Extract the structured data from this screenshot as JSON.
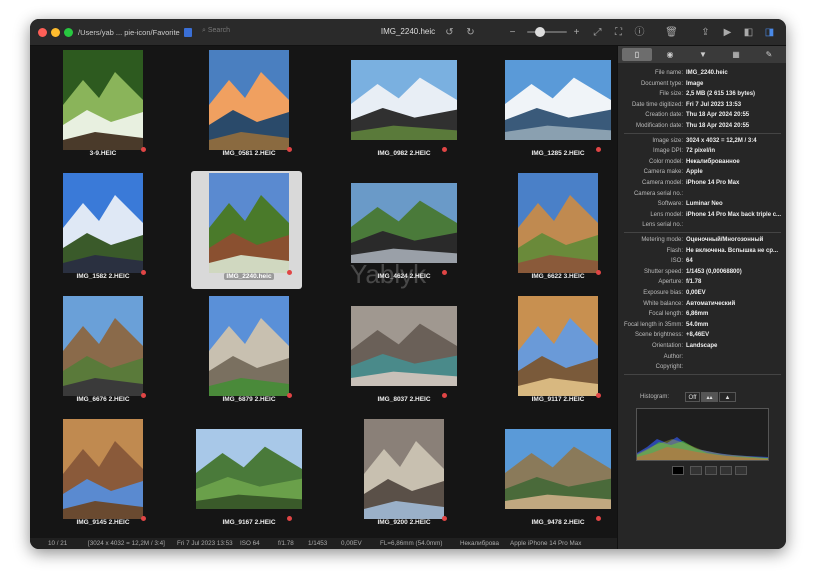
{
  "window": {
    "path": "/Users/yab ... pie-icon/Favorite",
    "search_placeholder": "Search",
    "title": "IMG_2240.heic",
    "watermark": "Yablyk"
  },
  "toolbar": {
    "icons": [
      "rotate-left-icon",
      "rotate-right-icon",
      "zoom-out-icon",
      "zoom-in-icon",
      "fit-icon",
      "fullscreen-icon",
      "info-icon",
      "trash-icon",
      "share-icon",
      "slideshow-icon",
      "sidebar-left-icon",
      "sidebar-right-icon"
    ]
  },
  "thumbnails": [
    {
      "name": "3-9.HEIC",
      "palette": [
        "#2d5a1f",
        "#8ab45a",
        "#e8f0e0",
        "#4a3a2a"
      ],
      "portrait": true
    },
    {
      "name": "IMG_0581 2.HEIC",
      "palette": [
        "#4a7fc0",
        "#f0a060",
        "#2a4a6a",
        "#8a6a40"
      ],
      "portrait": true
    },
    {
      "name": "IMG_0982 2.HEIC",
      "palette": [
        "#7ab0e0",
        "#e8eef5",
        "#303030",
        "#5a7a3a"
      ],
      "portrait": false
    },
    {
      "name": "IMG_1285 2.HEIC",
      "palette": [
        "#5a9ad8",
        "#f0f4f8",
        "#3a5a7a",
        "#8aa0b0"
      ],
      "portrait": false
    },
    {
      "name": "IMG_1582 2.HEIC",
      "palette": [
        "#3a7ad8",
        "#dfe8f5",
        "#3a5a2a",
        "#2a3040"
      ],
      "portrait": true
    },
    {
      "name": "IMG_2240.heic",
      "palette": [
        "#5a8ad0",
        "#4a7a2a",
        "#8a5030",
        "#d0d8c0"
      ],
      "portrait": true,
      "selected": true
    },
    {
      "name": "IMG_4624 2.HEIC",
      "palette": [
        "#6a9ac8",
        "#4a7a3a",
        "#2a2a2a",
        "#9aa0a8"
      ],
      "portrait": false
    },
    {
      "name": "IMG_6622 3.HEIC",
      "palette": [
        "#4a80c8",
        "#c08a50",
        "#6a8a3a",
        "#8a5a3a"
      ],
      "portrait": true
    },
    {
      "name": "IMG_6676 2.HEIC",
      "palette": [
        "#6aa0d8",
        "#8a6a4a",
        "#5a7a3a",
        "#3a3a3a"
      ],
      "portrait": true
    },
    {
      "name": "IMG_6879 2.HEIC",
      "palette": [
        "#5a90d8",
        "#c8c0b0",
        "#7a7060",
        "#4a8a3a"
      ],
      "portrait": true
    },
    {
      "name": "IMG_8037 2.HEIC",
      "palette": [
        "#a09890",
        "#6a6058",
        "#4a8a8a",
        "#c8c0b8"
      ],
      "portrait": false
    },
    {
      "name": "IMG_9117 2.HEIC",
      "palette": [
        "#c89050",
        "#6a9ad8",
        "#7a5a3a",
        "#d8b880"
      ],
      "portrait": true
    },
    {
      "name": "IMG_9145 2.HEIC",
      "palette": [
        "#c08a50",
        "#8a5a3a",
        "#5a8ad0",
        "#6a4a30"
      ],
      "portrait": true
    },
    {
      "name": "IMG_9167 2.HEIC",
      "palette": [
        "#a8c8e8",
        "#4a7a3a",
        "#6aa04a",
        "#3a5a2a"
      ],
      "portrait": false
    },
    {
      "name": "IMG_9200 2.HEIC",
      "palette": [
        "#8a8078",
        "#c8c0b0",
        "#5a5048",
        "#9ab0c8"
      ],
      "portrait": true
    },
    {
      "name": "IMG_9478 2.HEIC",
      "palette": [
        "#5a9ad8",
        "#8a7a5a",
        "#4a6a3a",
        "#c0a880"
      ],
      "portrait": false
    }
  ],
  "status": {
    "index": "10 / 21",
    "dims": "[3024 x 4032 = 12,2M / 3:4]",
    "date": "Fri 7 Jul 2023  13:53",
    "iso": "ISO 64",
    "aperture": "f/1.78",
    "shutter": "1/1453",
    "ev": "0,00EV",
    "fl": "FL=6,86mm (54.0mm)",
    "color": "Некалиброва",
    "camera": "Apple iPhone 14 Pro Max"
  },
  "panel": {
    "tabs": [
      "document-icon",
      "aperture-icon",
      "funnel-icon",
      "map-icon",
      "note-icon"
    ],
    "info_rows": [
      {
        "k": "File name:",
        "v": "IMG_2240.heic"
      },
      {
        "k": "Document type:",
        "v": "Image"
      },
      {
        "k": "File size:",
        "v": "2,5 MB (2 615 136 bytes)"
      },
      {
        "k": "Date time digitized:",
        "v": "Fri 7 Jul 2023  13:53"
      },
      {
        "k": "Creation date:",
        "v": "Thu 18 Apr 2024  20:55"
      },
      {
        "k": "Modification date:",
        "v": "Thu 18 Apr 2024  20:55"
      },
      {
        "k": "Image size:",
        "v": "3024 x 4032 = 12,2M / 3:4"
      },
      {
        "k": "Image DPI:",
        "v": "72 pixel/in"
      },
      {
        "k": "Color model:",
        "v": "Некалиброванное"
      },
      {
        "k": "Camera make:",
        "v": "Apple"
      },
      {
        "k": "Camera model:",
        "v": "iPhone 14 Pro Max"
      },
      {
        "k": "Camera serial no.:",
        "v": ""
      },
      {
        "k": "Software:",
        "v": "Luminar Neo"
      },
      {
        "k": "Lens model:",
        "v": "iPhone 14 Pro Max back triple c..."
      },
      {
        "k": "Lens serial no.:",
        "v": ""
      },
      {
        "k": "Metering mode:",
        "v": "Оценочный/Многозонный"
      },
      {
        "k": "Flash:",
        "v": "Не включена. Вспышка не ср..."
      },
      {
        "k": "ISO:",
        "v": "64"
      },
      {
        "k": "Shutter speed:",
        "v": "1/1453 (0,00068800)"
      },
      {
        "k": "Aperture:",
        "v": "f/1.78"
      },
      {
        "k": "Exposure bias:",
        "v": "0,00EV"
      },
      {
        "k": "White balance:",
        "v": "Автоматический"
      },
      {
        "k": "Focal length:",
        "v": "6,86mm"
      },
      {
        "k": "Focal length in 35mm:",
        "v": "54.0mm"
      },
      {
        "k": "Scene brightness:",
        "v": "+8,46EV"
      },
      {
        "k": "Orientation:",
        "v": "Landscape"
      },
      {
        "k": "Author:",
        "v": ""
      },
      {
        "k": "Copyright:",
        "v": ""
      }
    ],
    "histogram_label": "Histogram:",
    "histogram_off": "Off"
  }
}
